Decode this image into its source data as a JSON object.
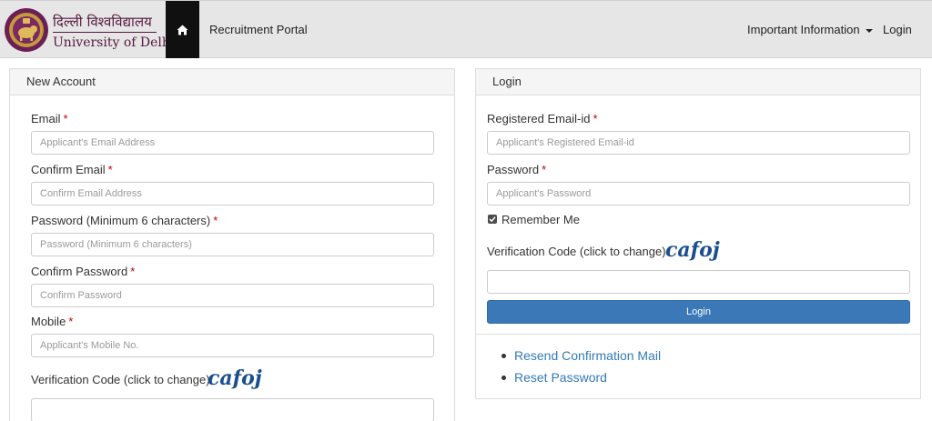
{
  "header": {
    "brand_hindi": "दिल्ली विश्वविद्यालय",
    "brand_english": "University of Delhi",
    "home_icon": "home-icon",
    "portal_label": "Recruitment Portal",
    "info_label": "Important Information",
    "login_label": "Login"
  },
  "new_account": {
    "title": "New Account",
    "email_label": "Email",
    "email_placeholder": "Applicant's Email Address",
    "confirm_email_label": "Confirm Email",
    "confirm_email_placeholder": "Confirm Email Address",
    "password_label": "Password (Minimum 6 characters)",
    "password_placeholder": "Password (Minimum 6 characters)",
    "confirm_password_label": "Confirm Password",
    "confirm_password_placeholder": "Confirm Password",
    "mobile_label": "Mobile",
    "mobile_placeholder": "Applicant's Mobile No.",
    "verification_label": "Verification Code (click to change)",
    "captcha_text": "cafoj",
    "verification_value": ""
  },
  "login": {
    "title": "Login",
    "email_label": "Registered Email-id",
    "email_placeholder": "Applicant's Registered Email-id",
    "password_label": "Password",
    "password_placeholder": "Applicant's Password",
    "remember_label": "Remember Me",
    "remember_checked": true,
    "verification_label": "Verification Code (click to change)",
    "captcha_text": "cafoj",
    "verification_value": "",
    "button_label": "Login",
    "links": [
      "Resend Confirmation Mail",
      "Reset Password"
    ]
  },
  "required_mark": "*",
  "colors": {
    "navbar": "#e6e6e6",
    "home_button": "#101010",
    "brand": "#55183f",
    "primary_button": "#3a78b7",
    "link": "#337ab7",
    "required": "#c00000"
  }
}
